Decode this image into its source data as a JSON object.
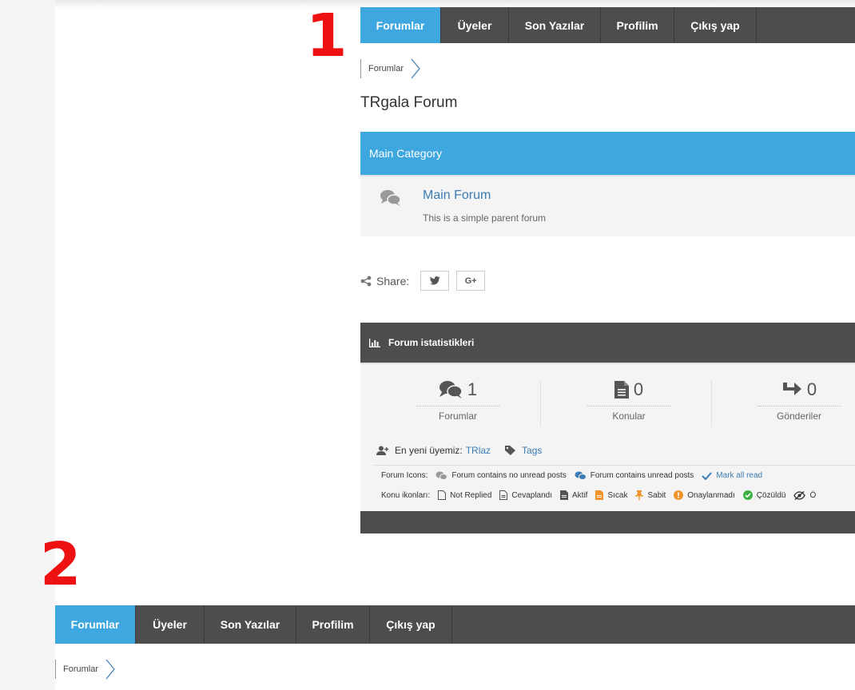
{
  "nav": [
    {
      "label": "Forumlar",
      "active": true
    },
    {
      "label": "Üyeler"
    },
    {
      "label": "Son Yazılar"
    },
    {
      "label": "Profilim"
    },
    {
      "label": "Çıkış yap"
    }
  ],
  "breadcrumb": "Forumlar",
  "page_title": "TRgala Forum",
  "category": {
    "title": "Main Category",
    "forum_name": "Main Forum",
    "forum_desc": "This is a simple parent forum"
  },
  "share": {
    "label": "Share:",
    "twitter_icon": "twitter-icon",
    "google_label": "G+"
  },
  "stats": {
    "title": "Forum istatistikleri",
    "forums": {
      "count": "1",
      "label": "Forumlar"
    },
    "topics": {
      "count": "0",
      "label": "Konular"
    },
    "replies": {
      "count": "0",
      "label": "Gönderiler"
    },
    "newest_label": "En yeni üyemiz:",
    "newest_user": "TRlaz",
    "tags": "Tags"
  },
  "legend": {
    "forum_icons_label": "Forum Icons:",
    "no_unread": "Forum contains no unread posts",
    "unread": "Forum contains unread posts",
    "mark_read": "Mark all read",
    "topic_icons_label": "Konu ikonları:",
    "not_replied": "Not Replied",
    "replied": "Cevaplandı",
    "active": "Aktif",
    "hot": "Sıcak",
    "sticky": "Sabit",
    "unapproved": "Onaylanmadı",
    "solved": "Çözüldü",
    "private_initial": "Ö"
  },
  "markers": {
    "first": "1",
    "second": "2"
  },
  "colors": {
    "accent": "#3fa7e0",
    "nav_bg": "#4d4d4d",
    "link": "#3b7cb5",
    "marker": "#ee1111"
  }
}
